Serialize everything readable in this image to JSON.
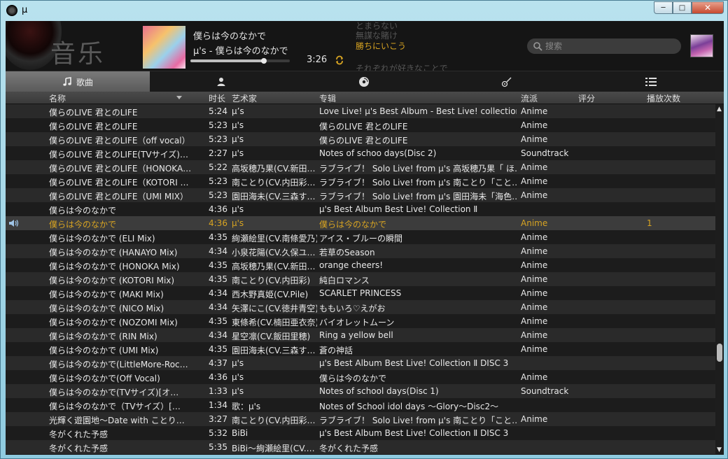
{
  "window": {
    "title": "μ"
  },
  "header": {
    "section_title": "音乐",
    "now_playing": {
      "title": "僕らは今のなかで",
      "subtitle": "μ's - 僕らは今のなかで",
      "time": "3:26",
      "progress": 0.74
    },
    "lyrics": [
      {
        "text": "とまらない",
        "active": false
      },
      {
        "text": "無謀な賭け",
        "active": false
      },
      {
        "text": "勝ちにいこう",
        "active": true
      },
      {
        "text": "それぞれが好きなことで",
        "active": false
      }
    ],
    "search": {
      "placeholder": "搜索",
      "value": ""
    }
  },
  "tabs": [
    {
      "icon": "music-note-icon",
      "label": "歌曲",
      "active": true
    },
    {
      "icon": "artist-icon",
      "label": "",
      "active": false
    },
    {
      "icon": "album-disc-icon",
      "label": "",
      "active": false
    },
    {
      "icon": "guitar-icon",
      "label": "",
      "active": false
    },
    {
      "icon": "list-icon",
      "label": "",
      "active": false
    }
  ],
  "columns": {
    "title": "名称",
    "duration": "时长",
    "artist": "艺术家",
    "album": "专辑",
    "genre": "流派",
    "rating": "评分",
    "plays": "播放次数"
  },
  "rows": [
    {
      "title": "僕らのLIVE 君とのLIFE",
      "duration": "5:24",
      "artist": "μ’s",
      "album": "Love Live! μ's Best Album - Best Live! collection (D…",
      "genre": "Anime",
      "rating": "",
      "plays": ""
    },
    {
      "title": "僕らのLIVE 君とのLIFE",
      "duration": "5:23",
      "artist": "μ's",
      "album": "僕らのLIVE 君とのLIFE",
      "genre": "Anime",
      "rating": "",
      "plays": ""
    },
    {
      "title": "僕らのLIVE 君とのLIFE（off vocal）",
      "duration": "5:23",
      "artist": "μ's",
      "album": "僕らのLIVE 君とのLIFE",
      "genre": "Anime",
      "rating": "",
      "plays": ""
    },
    {
      "title": "僕らのLIVE 君とのLIFE(TVサイズ)…",
      "duration": "2:27",
      "artist": "μ's",
      "album": "Notes of schoo days(Disc 2)",
      "genre": "Soundtrack",
      "rating": "",
      "plays": ""
    },
    {
      "title": "僕らのLIVE 君とのLIFE（HONOKA…",
      "duration": "5:22",
      "artist": "高坂穂乃果(CV.新田…",
      "album": "ラブライブ！ Solo Live! from μ's 高坂穂乃果「 ほ…",
      "genre": "Anime",
      "rating": "",
      "plays": ""
    },
    {
      "title": "僕らのLIVE 君とのLIFE（KOTORI …",
      "duration": "5:23",
      "artist": "南ことり(CV.内田彩…",
      "album": "ラブライブ！ Solo Live! from μ's 南ことり「こと…",
      "genre": "Anime",
      "rating": "",
      "plays": ""
    },
    {
      "title": "僕らのLIVE 君とのLIFE（UMI MIX）",
      "duration": "5:23",
      "artist": "園田海未(CV.三森す…",
      "album": "ラブライブ！ Solo Live! from μ's 園田海未「海色…",
      "genre": "Anime",
      "rating": "",
      "plays": ""
    },
    {
      "title": "僕らは今のなかで",
      "duration": "4:36",
      "artist": "μ's",
      "album": "μ's Best Album Best Live! Collection Ⅱ",
      "genre": "",
      "rating": "",
      "plays": ""
    },
    {
      "title": "僕らは今のなかで",
      "duration": "4:36",
      "artist": "μ's",
      "album": "僕らは今のなかで",
      "genre": "Anime",
      "rating": "",
      "plays": "1",
      "playing": true
    },
    {
      "title": "僕らは今のなかで (ELI Mix)",
      "duration": "4:35",
      "artist": "絢瀬絵里(CV.南條愛乃)",
      "album": "アイス・ブルーの瞬間",
      "genre": "Anime",
      "rating": "",
      "plays": ""
    },
    {
      "title": "僕らは今のなかで (HANAYO Mix)",
      "duration": "4:34",
      "artist": "小泉花陽(CV.久保ユ…",
      "album": "若草のSeason",
      "genre": "Anime",
      "rating": "",
      "plays": ""
    },
    {
      "title": "僕らは今のなかで (HONOKA Mix)",
      "duration": "4:35",
      "artist": "高坂穂乃果(CV.新田…",
      "album": "orange cheers!",
      "genre": "Anime",
      "rating": "",
      "plays": ""
    },
    {
      "title": "僕らは今のなかで (KOTORI Mix)",
      "duration": "4:35",
      "artist": "南ことり(CV.内田彩)",
      "album": "純白ロマンス",
      "genre": "Anime",
      "rating": "",
      "plays": ""
    },
    {
      "title": "僕らは今のなかで (MAKI Mix)",
      "duration": "4:34",
      "artist": "西木野真姫(CV.Pile)",
      "album": "SCARLET PRINCESS",
      "genre": "Anime",
      "rating": "",
      "plays": ""
    },
    {
      "title": "僕らは今のなかで (NICO Mix)",
      "duration": "4:34",
      "artist": "矢澤にこ(CV.徳井青空)",
      "album": "ももいろ♡えがお",
      "genre": "Anime",
      "rating": "",
      "plays": ""
    },
    {
      "title": "僕らは今のなかで (NOZOMI Mix)",
      "duration": "4:35",
      "artist": "東條希(CV.楠田亜衣奈)",
      "album": "バイオレットムーン",
      "genre": "Anime",
      "rating": "",
      "plays": ""
    },
    {
      "title": "僕らは今のなかで (RIN Mix)",
      "duration": "4:34",
      "artist": "星空凛(CV.飯田里穂)",
      "album": "Ring a yellow bell",
      "genre": "Anime",
      "rating": "",
      "plays": ""
    },
    {
      "title": "僕らは今のなかで (UMI Mix)",
      "duration": "4:35",
      "artist": "園田海未(CV.三森す…",
      "album": "蒼の神話",
      "genre": "Anime",
      "rating": "",
      "plays": ""
    },
    {
      "title": "僕らは今のなかで(LittleMore-Roc…",
      "duration": "4:37",
      "artist": "μ's",
      "album": "μ's Best Album Best Live! Collection Ⅱ DISC 3",
      "genre": "",
      "rating": "",
      "plays": ""
    },
    {
      "title": "僕らは今のなかで(Off Vocal)",
      "duration": "4:36",
      "artist": "μ's",
      "album": "僕らは今のなかで",
      "genre": "Anime",
      "rating": "",
      "plays": ""
    },
    {
      "title": "僕らは今のなかで(TVサイズ)[オ…",
      "duration": "1:33",
      "artist": "μ's",
      "album": "Notes of school days(Disc 1)",
      "genre": "Soundtrack",
      "rating": "",
      "plays": ""
    },
    {
      "title": "僕らは今のなかで（TVサイズ）[…",
      "duration": "1:34",
      "artist": "歌：μ's",
      "album": "Notes of School idol days ～Glory～Disc2～",
      "genre": "",
      "rating": "",
      "plays": ""
    },
    {
      "title": "光輝く遊園地～Date with ことり…",
      "duration": "3:27",
      "artist": "南ことり(CV.内田彩…",
      "album": "ラブライブ！ Solo Live! from μ's 南ことり「こと…",
      "genre": "Anime",
      "rating": "",
      "plays": ""
    },
    {
      "title": "冬がくれた予感",
      "duration": "5:32",
      "artist": "BiBi",
      "album": "μ's Best Album Best Live! Collection Ⅱ DISC 3",
      "genre": "",
      "rating": "",
      "plays": ""
    },
    {
      "title": "冬がくれた予感",
      "duration": "5:35",
      "artist": "BiBi～絢瀬絵里(CV.…",
      "album": "冬がくれた予感",
      "genre": "",
      "rating": "",
      "plays": ""
    }
  ],
  "colors": {
    "accent": "#d8a422",
    "row_odd": "#1c1c1c",
    "row_even": "#2a2a2a",
    "row_playing": "#3c3c3c"
  }
}
